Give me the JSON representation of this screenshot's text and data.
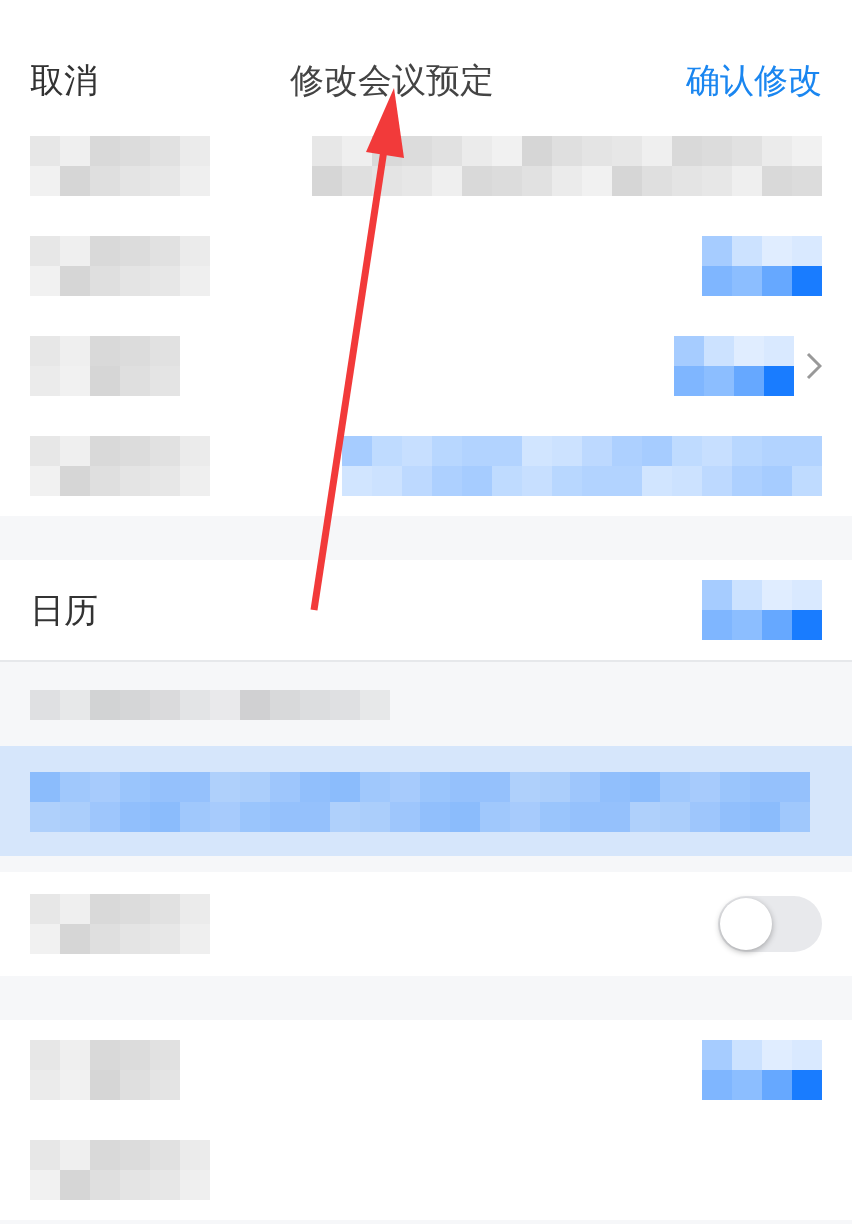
{
  "header": {
    "cancel": "取消",
    "title": "修改会议预定",
    "confirm": "确认修改"
  },
  "rows": [
    {
      "kind": "setting",
      "gap_before": false,
      "label_hidden": true,
      "value": {
        "kind": "grey"
      },
      "chevron": false
    },
    {
      "kind": "setting",
      "gap_before": false,
      "label_hidden": true,
      "value": {
        "kind": "blue"
      },
      "chevron": false
    },
    {
      "kind": "setting",
      "gap_before": false,
      "label_hidden": true,
      "value": {
        "kind": "blue"
      },
      "chevron": true
    },
    {
      "kind": "setting",
      "gap_before": false,
      "label_hidden": true,
      "value": {
        "kind": "wide"
      },
      "chevron": false
    },
    {
      "kind": "setting",
      "gap_before": true,
      "label": "日历",
      "value": {
        "kind": "blue"
      },
      "chevron": false
    },
    {
      "kind": "note"
    },
    {
      "kind": "highlight"
    },
    {
      "kind": "toggle",
      "gap_before": true,
      "label_hidden": true,
      "on": false
    },
    {
      "kind": "setting",
      "gap_before": true,
      "label_hidden": true,
      "value": {
        "kind": "blue"
      },
      "chevron": false
    },
    {
      "kind": "setting",
      "gap_before": false,
      "label_hidden": true,
      "chevron": false
    }
  ],
  "annotation": {
    "kind": "arrow"
  }
}
